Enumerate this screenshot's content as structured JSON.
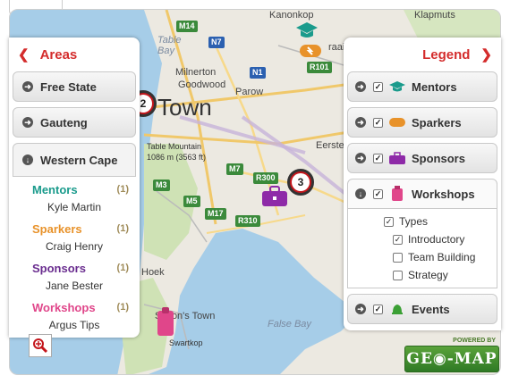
{
  "map": {
    "labels": {
      "kanonkop": "Kanonkop",
      "klapmuts": "Klapmuts",
      "table_bay": "Table\nBay",
      "milnerton": "Milnerton",
      "goodwood": "Goodwood",
      "parow": "Parow",
      "town": "Town",
      "table_mountain": "Table Mountain",
      "table_mountain_height": "1086 m (3563 ft)",
      "eerste": "Eersteri",
      "hoek": "Hoek",
      "simons_town": "Simon's Town",
      "swartkop": "Swartkop",
      "false_bay": "False Bay",
      "raaif": "raaif"
    },
    "shields": {
      "m14": "M14",
      "n7": "N7",
      "n1": "N1",
      "r101": "R101",
      "m7": "M7",
      "r300": "R300",
      "m3": "M3",
      "m5": "M5",
      "m17": "M17",
      "r310": "R310"
    },
    "clusters": {
      "left_count": "2",
      "center_count": "3"
    }
  },
  "areas": {
    "title": "Areas",
    "items": [
      {
        "label": "Free State"
      },
      {
        "label": "Gauteng"
      },
      {
        "label": "Western Cape"
      }
    ],
    "western_cape": {
      "categories": [
        {
          "label": "Mentors",
          "count": "(1)",
          "member": "Kyle Martin",
          "color": "#1a9b8c"
        },
        {
          "label": "Sparkers",
          "count": "(1)",
          "member": "Craig Henry",
          "color": "#e8922a"
        },
        {
          "label": "Sponsors",
          "count": "(1)",
          "member": "Jane Bester",
          "color": "#6a2d8f"
        },
        {
          "label": "Workshops",
          "count": "(1)",
          "member": "Argus Tips",
          "color": "#e0468a"
        }
      ]
    }
  },
  "legend": {
    "title": "Legend",
    "items": [
      {
        "label": "Mentors",
        "icon": "graduation-cap-icon"
      },
      {
        "label": "Sparkers",
        "icon": "sparker-icon"
      },
      {
        "label": "Sponsors",
        "icon": "briefcase-icon"
      },
      {
        "label": "Workshops",
        "icon": "clipboard-icon"
      }
    ],
    "types_label": "Types",
    "types": [
      {
        "label": "Introductory",
        "checked": true
      },
      {
        "label": "Team Building",
        "checked": false
      },
      {
        "label": "Strategy",
        "checked": false
      }
    ],
    "events_label": "Events"
  },
  "brand": {
    "powered": "POWERED BY",
    "logo": "GE◉-MAP"
  },
  "colors": {
    "accent": "#d42c2c",
    "mentors": "#1a9b8c",
    "sparkers": "#e8922a",
    "sponsors": "#8e2aa8",
    "workshops": "#e0468a",
    "events": "#3ba035"
  }
}
